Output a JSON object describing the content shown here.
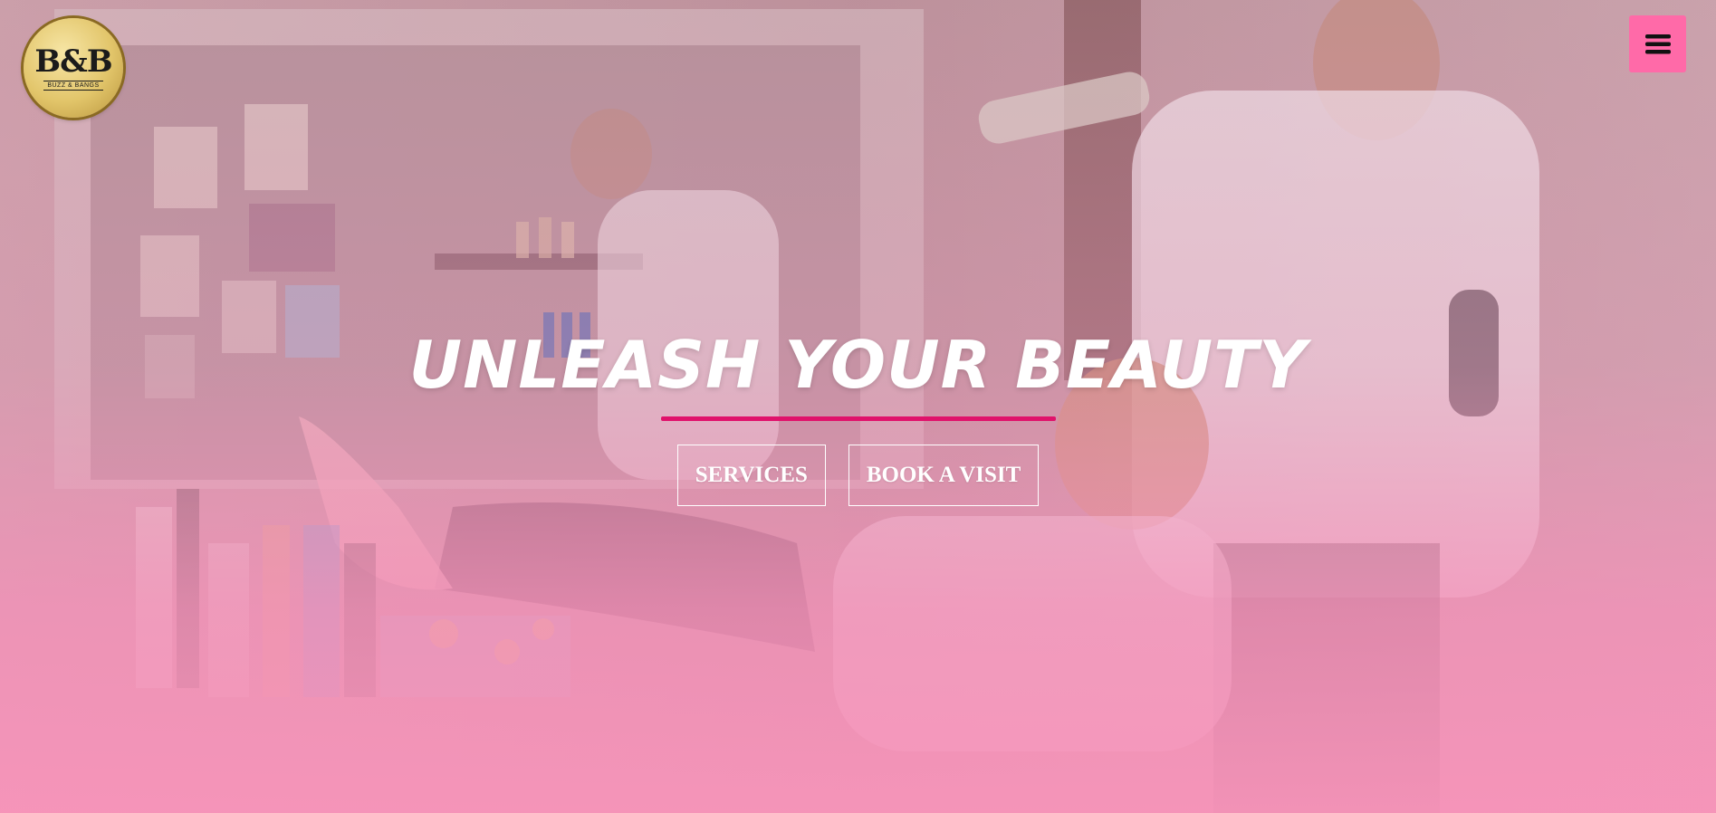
{
  "brand": {
    "logo_mark": "B&B",
    "logo_sub": "BUZZ & BANGS"
  },
  "nav": {
    "menu_icon": "hamburger-icon",
    "menu_color": "#ff6aa8"
  },
  "hero": {
    "title": "UNLEASH YOUR BEAUTY",
    "accent_color": "#e0126b",
    "buttons": [
      {
        "label": "SERVICES"
      },
      {
        "label": "BOOK A VISIT"
      }
    ]
  }
}
